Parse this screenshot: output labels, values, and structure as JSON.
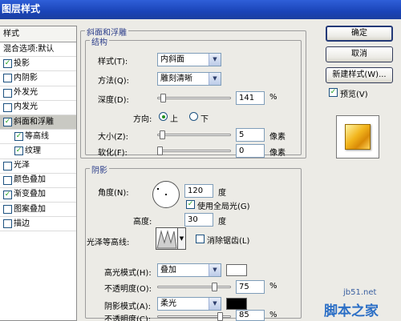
{
  "window": {
    "title": "图层样式"
  },
  "style_list": {
    "header": "样式",
    "items": [
      {
        "label": "混合选项:默认",
        "checkbox": false,
        "checked": false,
        "selected": false,
        "sub": false
      },
      {
        "label": "投影",
        "checkbox": true,
        "checked": true,
        "selected": false,
        "sub": false
      },
      {
        "label": "内阴影",
        "checkbox": true,
        "checked": false,
        "selected": false,
        "sub": false
      },
      {
        "label": "外发光",
        "checkbox": true,
        "checked": false,
        "selected": false,
        "sub": false
      },
      {
        "label": "内发光",
        "checkbox": true,
        "checked": false,
        "selected": false,
        "sub": false
      },
      {
        "label": "斜面和浮雕",
        "checkbox": true,
        "checked": true,
        "selected": true,
        "sub": false
      },
      {
        "label": "等高线",
        "checkbox": true,
        "checked": true,
        "selected": false,
        "sub": true
      },
      {
        "label": "纹理",
        "checkbox": true,
        "checked": true,
        "selected": false,
        "sub": true
      },
      {
        "label": "光泽",
        "checkbox": true,
        "checked": false,
        "selected": false,
        "sub": false
      },
      {
        "label": "颜色叠加",
        "checkbox": true,
        "checked": false,
        "selected": false,
        "sub": false
      },
      {
        "label": "渐变叠加",
        "checkbox": true,
        "checked": true,
        "selected": false,
        "sub": false
      },
      {
        "label": "图案叠加",
        "checkbox": true,
        "checked": false,
        "selected": false,
        "sub": false
      },
      {
        "label": "描边",
        "checkbox": true,
        "checked": false,
        "selected": false,
        "sub": false
      }
    ]
  },
  "bevel": {
    "title": "斜面和浮雕",
    "structure_title": "结构",
    "style_label": "样式(T):",
    "style_value": "内斜面",
    "technique_label": "方法(Q):",
    "technique_value": "雕刻清晰",
    "depth_label": "深度(D):",
    "depth_value": "141",
    "depth_unit": "%",
    "direction_label": "方向:",
    "direction_up": "上",
    "direction_down": "下",
    "size_label": "大小(Z):",
    "size_value": "5",
    "size_unit": "像素",
    "soften_label": "软化(F):",
    "soften_value": "0",
    "soften_unit": "像素"
  },
  "shading": {
    "title": "阴影",
    "angle_label": "角度(N):",
    "angle_value": "120",
    "angle_unit": "度",
    "global_light_label": "使用全局光(G)",
    "altitude_label": "高度:",
    "altitude_value": "30",
    "altitude_unit": "度",
    "gloss_contour_label": "光泽等高线:",
    "antialias_label": "消除锯齿(L)",
    "highlight_mode_label": "高光模式(H):",
    "highlight_mode_value": "叠加",
    "highlight_color": "#ffffff",
    "highlight_opacity_label": "不透明度(O):",
    "highlight_opacity_value": "75",
    "highlight_opacity_unit": "%",
    "shadow_mode_label": "阴影模式(A):",
    "shadow_mode_value": "柔光",
    "shadow_color": "#000000",
    "shadow_opacity_label": "不透明度(C):",
    "shadow_opacity_value": "85",
    "shadow_opacity_unit": "%"
  },
  "buttons": {
    "ok": "确定",
    "cancel": "取消",
    "new_style": "新建样式(W)...",
    "preview": "预览(V)"
  },
  "watermark": {
    "site": "jb51.net",
    "brand": "脚本之家"
  },
  "colors": {
    "title_bar": "#1a44b8",
    "selected_item": "#c9c9c3"
  }
}
